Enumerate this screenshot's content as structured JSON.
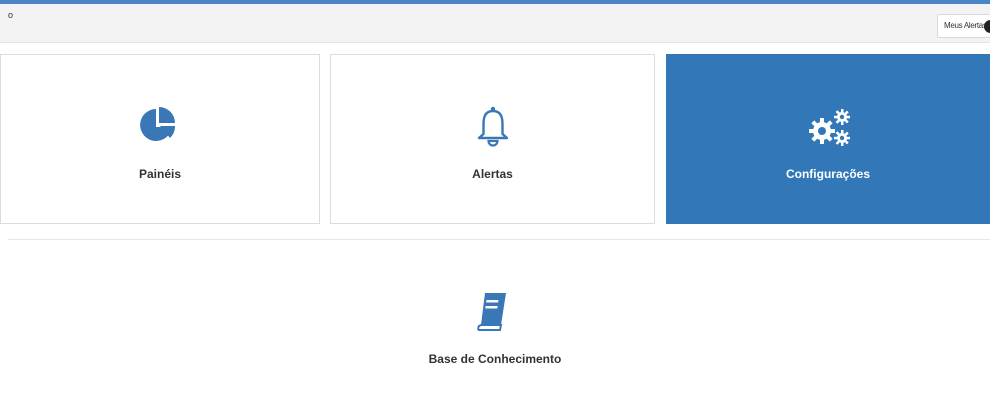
{
  "header": {
    "breadcrumb": "o",
    "alerts_label": "Meus Alertas"
  },
  "tiles": [
    {
      "label": "Painéis",
      "icon": "pie-chart-icon"
    },
    {
      "label": "Alertas",
      "icon": "bell-icon"
    },
    {
      "label": "Configurações",
      "icon": "gears-icon"
    }
  ],
  "knowledge_base": {
    "label": "Base de Conhecimento",
    "icon": "book-icon"
  },
  "colors": {
    "accent": "#3278b9",
    "icon": "#3a77b6",
    "text": "#333333",
    "topbar": "#f3f3f3"
  }
}
